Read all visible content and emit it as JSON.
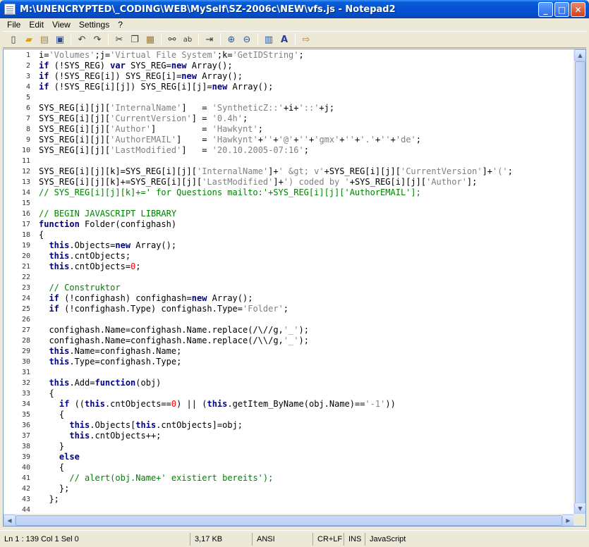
{
  "window": {
    "title": "M:\\UNENCRYPTED\\_CODING\\WEB\\MySelf\\SZ-2006c\\NEW\\vfs.js - Notepad2",
    "buttons": [
      "minimize",
      "maximize",
      "close"
    ]
  },
  "menu": {
    "items": [
      "File",
      "Edit",
      "View",
      "Settings",
      "?"
    ]
  },
  "toolbar": {
    "icons": [
      "new-file-icon",
      "open-folder-icon",
      "browse-icon",
      "save-icon",
      "undo-icon",
      "redo-icon",
      "cut-icon",
      "copy-icon",
      "paste-icon",
      "find-icon",
      "replace-icon",
      "word-wrap-icon",
      "zoom-in-icon",
      "zoom-out-icon",
      "scheme-icon",
      "font-icon",
      "exit-icon"
    ]
  },
  "editor": {
    "line_numbers": [
      "1",
      "2",
      "3",
      "4",
      "5",
      "6",
      "7",
      "8",
      "9",
      "10",
      "11",
      "12",
      "13",
      "14",
      "15",
      "16",
      "17",
      "18",
      "19",
      "20",
      "21",
      "22",
      "23",
      "24",
      "25",
      "26",
      "27",
      "28",
      "29",
      "30",
      "31",
      "32",
      "33",
      "34",
      "35",
      "36",
      "37",
      "38",
      "39",
      "40",
      "41",
      "42",
      "43",
      "44"
    ],
    "lines": [
      "i='Volumes';j='Virtual File System';k='GetIDString';",
      "if (!SYS_REG) var SYS_REG=new Array();",
      "if (!SYS_REG[i]) SYS_REG[i]=new Array();",
      "if (!SYS_REG[i][j]) SYS_REG[i][j]=new Array();",
      "",
      "SYS_REG[i][j]['InternalName']   = 'SyntheticZ::'+i+'::'+j;",
      "SYS_REG[i][j]['CurrentVersion'] = '0.4h';",
      "SYS_REG[i][j]['Author']         = 'Hawkynt';",
      "SYS_REG[i][j]['AuthorEMAIL']    = 'Hawkynt'+''+'@'+''+'gmx'+''+'.'+''+'de';",
      "SYS_REG[i][j]['LastModified']   = '20.10.2005-07:16';",
      "",
      "SYS_REG[i][j][k]=SYS_REG[i][j]['InternalName']+' &gt; v'+SYS_REG[i][j]['CurrentVersion']+'(';",
      "SYS_REG[i][j][k]+=SYS_REG[i][j]['LastModified']+') coded by '+SYS_REG[i][j]['Author'];",
      "// SYS_REG[i][j][k]+=' for Questions mailto:'+SYS_REG[i][j]['AuthorEMAIL'];",
      "",
      "// BEGIN JAVASCRIPT LIBRARY",
      "function Folder(confighash)",
      "{",
      "  this.Objects=new Array();",
      "  this.cntObjects;",
      "  this.cntObjects=0;",
      "",
      "  // Construktor",
      "  if (!confighash) confighash=new Array();",
      "  if (!confighash.Type) confighash.Type='Folder';",
      "",
      "  confighash.Name=confighash.Name.replace(/\\//g,'_');",
      "  confighash.Name=confighash.Name.replace(/\\\\/g,'_');",
      "  this.Name=confighash.Name;",
      "  this.Type=confighash.Type;",
      "",
      "  this.Add=function(obj)",
      "  {",
      "    if ((this.cntObjects==0) || (this.getItem_ByName(obj.Name)=='-1'))",
      "    {",
      "      this.Objects[this.cntObjects]=obj;",
      "      this.cntObjects++;",
      "    }",
      "    else",
      "    {",
      "      // alert(obj.Name+' existiert bereits');",
      "    };",
      "  };",
      ""
    ]
  },
  "statusbar": {
    "position": "Ln 1 : 139   Col 1   Sel 0",
    "size": "3,17 KB",
    "encoding": "ANSI",
    "line_endings": "CR+LF",
    "insert_mode": "INS",
    "scheme": "JavaScript"
  },
  "colors": {
    "keyword": "#000080",
    "string": "#808080",
    "number": "#ff0000",
    "comment": "#008000",
    "titlebar": "#0453d2"
  }
}
